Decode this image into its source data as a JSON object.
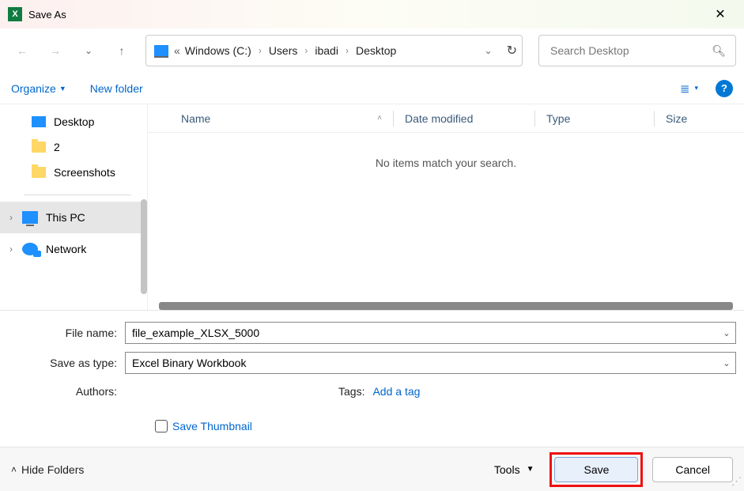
{
  "title": "Save As",
  "nav": {
    "drive": "Windows (C:)",
    "segs": [
      "Users",
      "ibadi",
      "Desktop"
    ],
    "search_placeholder": "Search Desktop"
  },
  "toolbar": {
    "organize": "Organize",
    "new_folder": "New folder"
  },
  "sidebar": {
    "quick": [
      {
        "label": "Desktop",
        "icon": "monitor"
      },
      {
        "label": "2",
        "icon": "folder"
      },
      {
        "label": "Screenshots",
        "icon": "folder"
      }
    ],
    "groups": [
      {
        "label": "This PC",
        "icon": "pc",
        "selected": true
      },
      {
        "label": "Network",
        "icon": "net",
        "selected": false
      }
    ]
  },
  "columns": {
    "name": "Name",
    "date": "Date modified",
    "type": "Type",
    "size": "Size"
  },
  "empty_message": "No items match your search.",
  "form": {
    "filename_label": "File name:",
    "filename_value": "file_example_XLSX_5000",
    "savetype_label": "Save as type:",
    "savetype_value": "Excel Binary Workbook",
    "authors_label": "Authors:",
    "tags_label": "Tags:",
    "add_tag": "Add a tag",
    "thumb_label": "Save Thumbnail"
  },
  "footer": {
    "hide_folders": "Hide Folders",
    "tools": "Tools",
    "save": "Save",
    "cancel": "Cancel"
  }
}
